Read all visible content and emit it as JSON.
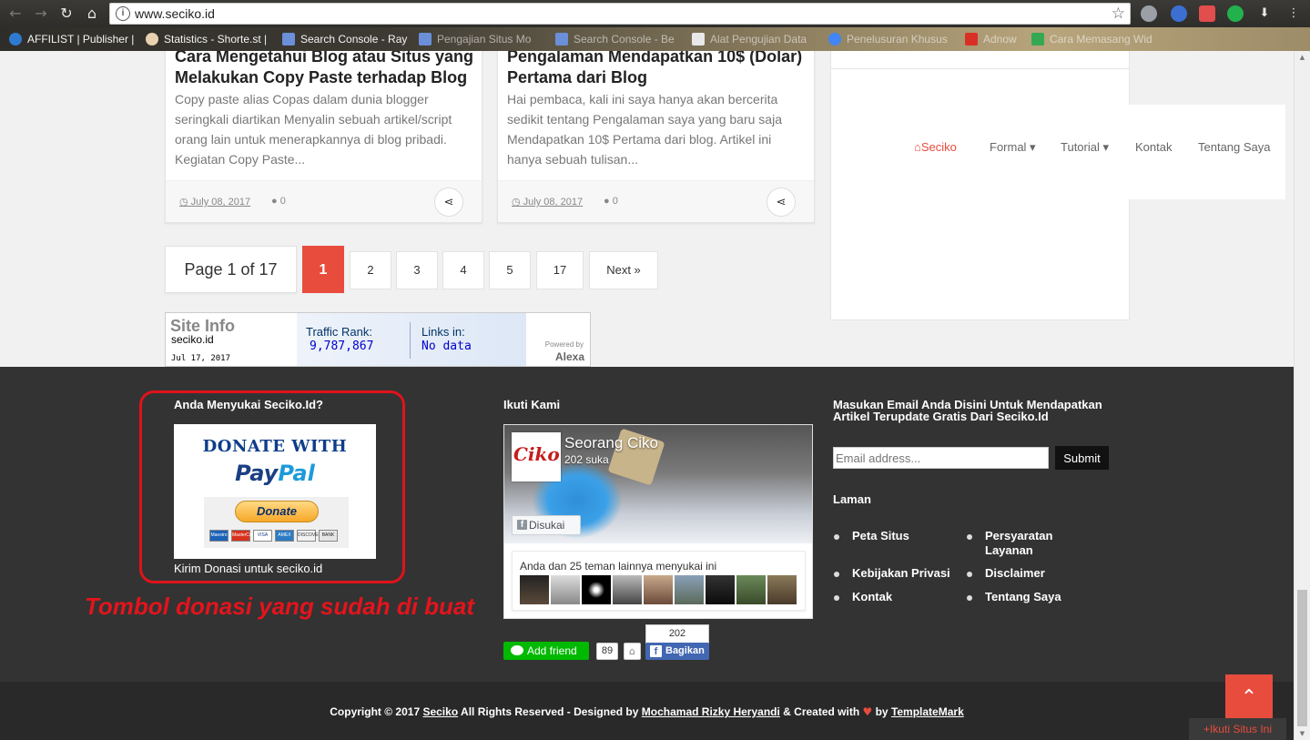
{
  "browser": {
    "url": "www.seciko.id",
    "back_icon": "back-arrow-icon",
    "forward_icon": "forward-arrow-icon",
    "reload_icon": "reload-icon",
    "home_icon": "home-icon",
    "bookmarks": [
      {
        "label": "AFFILIST | Publisher |",
        "color": "#2e7ad1"
      },
      {
        "label": "Statistics - Shorte.st |",
        "color": "#e8d2b0"
      },
      {
        "label": "Search Console - Ray",
        "color": "#6b8fd8"
      },
      {
        "label": "Pengajian Situs Mo",
        "color": "#6b8fd8"
      },
      {
        "label": "Search Console - Be",
        "color": "#6b8fd8"
      },
      {
        "label": "Alat Pengujian Data",
        "color": "#e8e8e8"
      },
      {
        "label": "Penelusuran Khusus",
        "color": "#4285f4"
      },
      {
        "label": "Adnow",
        "color": "#d93025"
      },
      {
        "label": "Cara Memasang Wid",
        "color": "#34a853"
      }
    ]
  },
  "posts": [
    {
      "title": "Cara Mengetahui Blog atau Situs yang Melakukan Copy Paste terhadap Blog",
      "excerpt": "Copy paste alias Copas dalam dunia blogger seringkali diartikan Menyalin sebuah artikel/script orang lain untuk menerapkannya di blog pribadi. Kegiatan Copy Paste...",
      "date": "July 08, 2017",
      "comments": "0"
    },
    {
      "title": "Pengalaman Mendapatkan 10$ (Dolar) Pertama dari Blog",
      "excerpt": "Hai pembaca, kali ini saya hanya akan bercerita sedikit tentang Pengalaman saya yang baru saja Mendapatkan 10$ Pertama dari blog. Artikel ini hanya sebuah tulisan...",
      "date": "July 08, 2017",
      "comments": "0"
    }
  ],
  "navbar": {
    "items": [
      {
        "label": "⌂Seciko",
        "active": true
      },
      {
        "label": "Formal ▾"
      },
      {
        "label": "Tutorial ▾"
      },
      {
        "label": "Kontak"
      },
      {
        "label": "Tentang Saya"
      }
    ]
  },
  "pagination": {
    "label": "Page 1 of 17",
    "pages": [
      "1",
      "2",
      "3",
      "4",
      "5",
      "17",
      "Next »"
    ],
    "current": "1"
  },
  "alexa": {
    "title": "Site Info",
    "domain": "seciko.id",
    "date": "Jul 17, 2017",
    "traffic_label": "Traffic Rank:",
    "traffic_value": "9,787,867",
    "links_label": "Links in:",
    "links_value": "No data",
    "powered": "Powered by",
    "brand": "Alexa"
  },
  "footer": {
    "donate": {
      "title": "Anda Menyukai Seciko.Id?",
      "headline": "DONATE WITH",
      "paypal_a": "Pay",
      "paypal_b": "Pal",
      "button": "Donate",
      "cards": [
        "Maestro",
        "MasterCard",
        "VISA",
        "AMEX",
        "DISCOVER",
        "BANK"
      ],
      "caption": "Kirim Donasi untuk seciko.id"
    },
    "annotation": "Tombol donasi yang sudah di buat",
    "follow": {
      "title": "Ikuti Kami",
      "page_name": "Seorang Ciko",
      "logo_text": "Ciko",
      "likes": "202 suka",
      "liked_button": "Disukai",
      "friends_text": "Anda dan 25 teman lainnya menyukai ini",
      "line_label": "Add friend",
      "line_count": "89",
      "share_count": "202",
      "share_label": "Bagikan"
    },
    "newsletter": {
      "title": "Masukan Email Anda Disini Untuk Mendapatkan Artikel Terupdate Gratis Dari Seciko.Id",
      "placeholder": "Email address...",
      "submit": "Submit"
    },
    "laman": {
      "title": "Laman",
      "links": [
        "Peta Situs",
        "Persyaratan Layanan",
        "Kebijakan Privasi",
        "Disclaimer",
        "Kontak",
        "Tentang Saya"
      ]
    },
    "copyright": {
      "prefix": "Copyright © 2017 ",
      "site": "Seciko",
      "middle": " All Rights Reserved - Designed by ",
      "designer": "Mochamad Rizky Heryandi",
      "created": " & Created with ",
      "by": " by ",
      "brand": "TemplateMark"
    },
    "follow_site": "+Ikuti Situs Ini"
  },
  "colors": {
    "accent": "#e84c3d",
    "footer_bg": "#333333",
    "annotation": "#e3141c"
  }
}
